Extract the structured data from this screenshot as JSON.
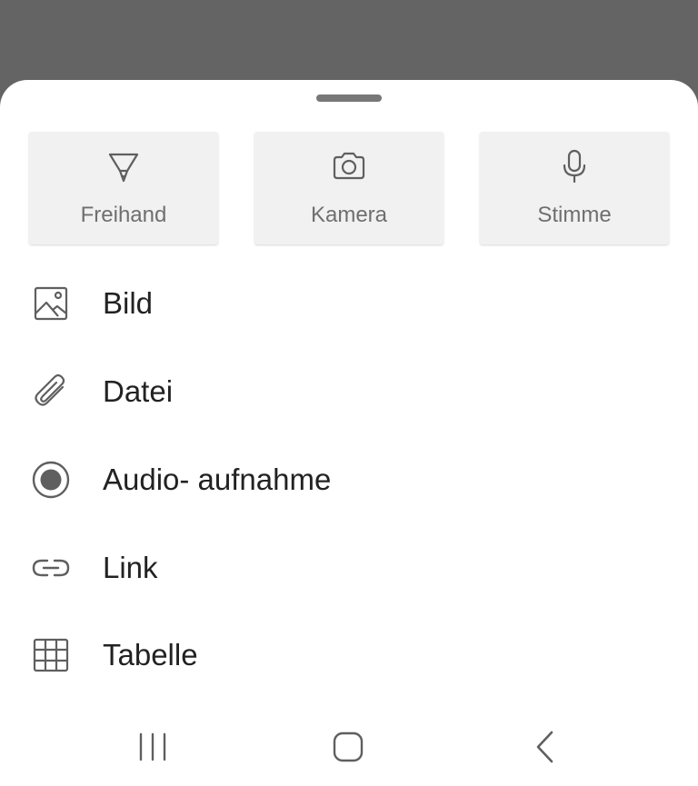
{
  "tiles": [
    {
      "label": "Freihand",
      "icon": "pen-icon"
    },
    {
      "label": "Kamera",
      "icon": "camera-icon"
    },
    {
      "label": "Stimme",
      "icon": "microphone-icon"
    }
  ],
  "menu": {
    "items": [
      {
        "label": "Bild",
        "icon": "image-icon"
      },
      {
        "label": "Datei",
        "icon": "paperclip-icon"
      },
      {
        "label": "Audio- aufnahme",
        "icon": "record-icon"
      },
      {
        "label": "Link",
        "icon": "link-icon"
      },
      {
        "label": "Tabelle",
        "icon": "table-icon"
      }
    ]
  },
  "navbar": {
    "buttons": [
      "recent-apps-icon",
      "home-icon",
      "back-icon"
    ]
  },
  "colors": {
    "backdrop": "#646464",
    "sheet": "#ffffff",
    "tile_background": "#f1f1f1",
    "tile_text": "#6f6f6f",
    "item_text": "#222222",
    "icon": "#5f5f5f"
  }
}
